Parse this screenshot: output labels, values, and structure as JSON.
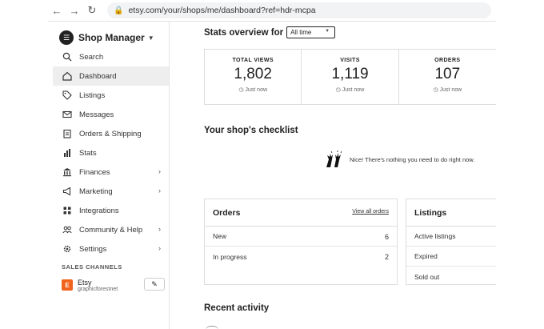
{
  "browser": {
    "url": "etsy.com/your/shops/me/dashboard?ref=hdr-mcpa"
  },
  "sidebar": {
    "brand": "Shop Manager",
    "items": [
      {
        "label": "Search",
        "icon": "search-icon"
      },
      {
        "label": "Dashboard",
        "icon": "home-icon",
        "active": true
      },
      {
        "label": "Listings",
        "icon": "tags-icon"
      },
      {
        "label": "Messages",
        "icon": "envelope-icon"
      },
      {
        "label": "Orders & Shipping",
        "icon": "clipboard-icon"
      },
      {
        "label": "Stats",
        "icon": "bar-chart-icon"
      },
      {
        "label": "Finances",
        "icon": "bank-icon",
        "chevron": true
      },
      {
        "label": "Marketing",
        "icon": "megaphone-icon",
        "chevron": true
      },
      {
        "label": "Integrations",
        "icon": "grid-icon"
      },
      {
        "label": "Community & Help",
        "icon": "people-icon",
        "chevron": true
      },
      {
        "label": "Settings",
        "icon": "gear-icon",
        "chevron": true
      }
    ],
    "sales_channels_label": "SALES CHANNELS",
    "channel": {
      "logo": "E",
      "name": "Etsy",
      "shop": "graphicforestnet"
    }
  },
  "stats": {
    "title": "Stats overview for",
    "range": "All time",
    "cards": [
      {
        "label": "TOTAL VIEWS",
        "value": "1,802",
        "time": "Just now"
      },
      {
        "label": "VISITS",
        "value": "1,119",
        "time": "Just now"
      },
      {
        "label": "ORDERS",
        "value": "107",
        "time": "Just now"
      }
    ]
  },
  "checklist": {
    "title": "Your shop's checklist",
    "message": "Nice! There's nothing you need to do right now."
  },
  "orders": {
    "title": "Orders",
    "link": "View all orders",
    "rows": [
      {
        "label": "New",
        "count": "6"
      },
      {
        "label": "In progress",
        "count": "2"
      }
    ]
  },
  "listings": {
    "title": "Listings",
    "rows": [
      "Active listings",
      "Expired",
      "Sold out"
    ]
  },
  "recent": {
    "title": "Recent activity"
  },
  "colors": {
    "etsy_orange": "#f1641e",
    "active_bg": "#eeeeee"
  }
}
